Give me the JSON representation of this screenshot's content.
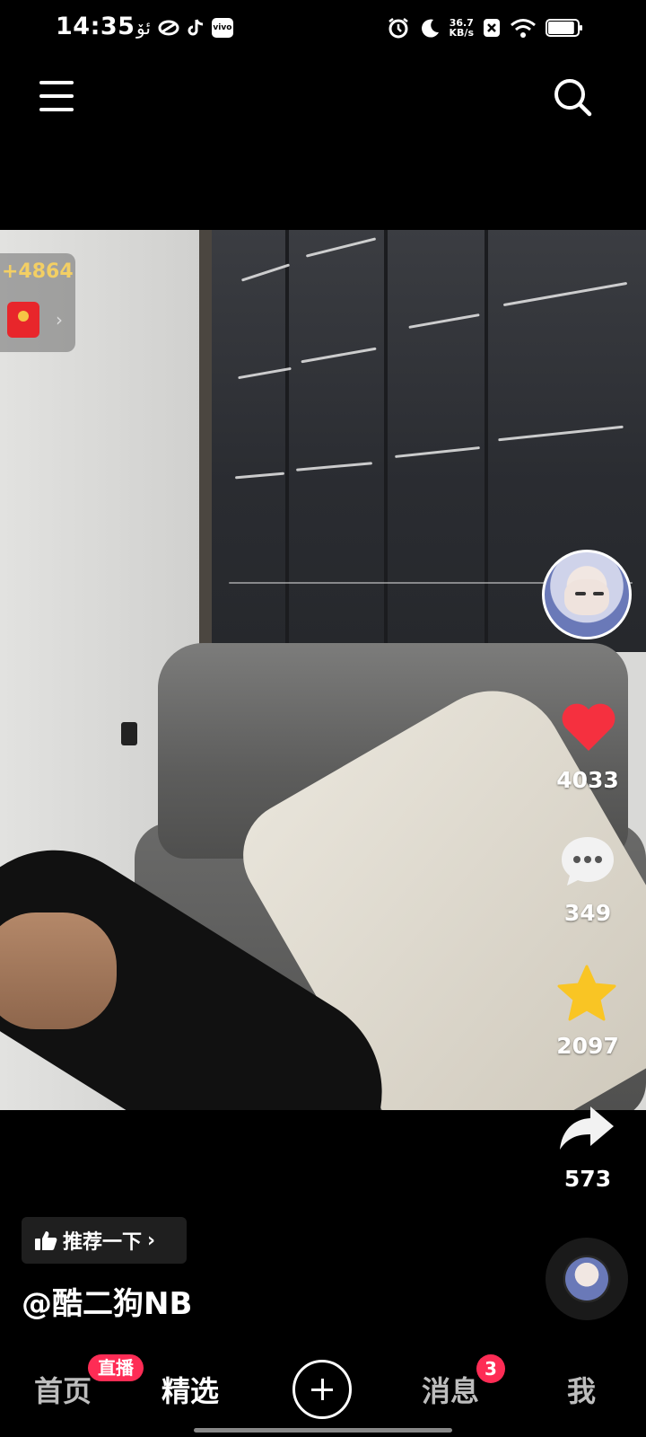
{
  "status_bar": {
    "time": "14:35",
    "notif_text": "ئۆ",
    "vivo_label": "vivo",
    "speed_value": "36.7",
    "speed_unit": "KB/s",
    "battery_level": 0.9
  },
  "top_bar": {
    "menu_icon": "hamburger-menu-icon",
    "search_icon": "search-icon"
  },
  "reward": {
    "amount": "+4864",
    "icon": "red-envelope-icon"
  },
  "author": {
    "avatar_icon": "author-avatar"
  },
  "actions": {
    "like_count": "4033",
    "comment_count": "349",
    "favorite_count": "2097",
    "share_count": "573"
  },
  "video_info": {
    "recommend_label": "推荐一下",
    "username": "@酷二狗NB"
  },
  "nav": {
    "home": "首页",
    "live_badge": "直播",
    "featured": "精选",
    "messages": "消息",
    "messages_badge": "3",
    "me": "我"
  },
  "colors": {
    "accent": "#fe2c55",
    "like_red": "#f5303f",
    "star_yellow": "#f9c524",
    "reward_gold": "#f3cf64"
  }
}
